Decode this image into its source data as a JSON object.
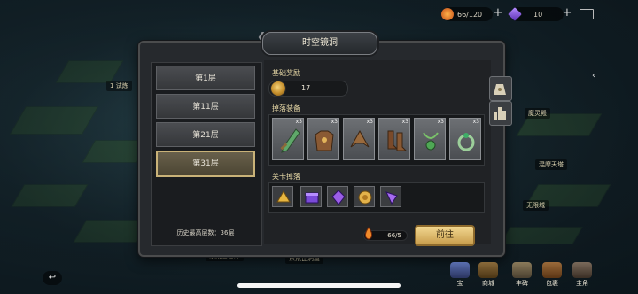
{
  "topbar": {
    "stamina": "66/120",
    "gems": "10"
  },
  "dialog": {
    "title": "时空镜洞",
    "layers": [
      "第1层",
      "第11层",
      "第21层",
      "第31层"
    ],
    "selected_layer_index": 3,
    "history_best": "历史最高层数：36层",
    "basic_reward_label": "基础奖励",
    "basic_reward_value": "17",
    "drop_equipment_label": "掉落装备",
    "equipment": [
      {
        "icon": "sword-icon",
        "qty": "x3"
      },
      {
        "icon": "armor-icon",
        "qty": "x3"
      },
      {
        "icon": "helmet-icon",
        "qty": "x3"
      },
      {
        "icon": "boots-icon",
        "qty": "x3"
      },
      {
        "icon": "amulet-icon",
        "qty": "x3"
      },
      {
        "icon": "ring-icon",
        "qty": "x3"
      }
    ],
    "stage_drops_label": "关卡掉落",
    "stage_drops": [
      "gold-helmet-icon",
      "purple-box-icon",
      "purple-crystal-icon",
      "gold-coin-icon",
      "purple-gem-icon"
    ],
    "stamina_cost": "66/5",
    "go_button": "前往"
  },
  "map_labels": {
    "a": "1 试炼",
    "b": "东荒亡谷泽",
    "c": "东荒昆洞窟",
    "d": "魔灵殿",
    "e": "混摩天塔",
    "f": "无限城"
  },
  "bottom_nav": [
    "宝",
    "商城",
    "丰碑",
    "包裹",
    "主角"
  ],
  "colors": {
    "accent_gold": "#c9b278",
    "panel_bg": "#26292d"
  }
}
